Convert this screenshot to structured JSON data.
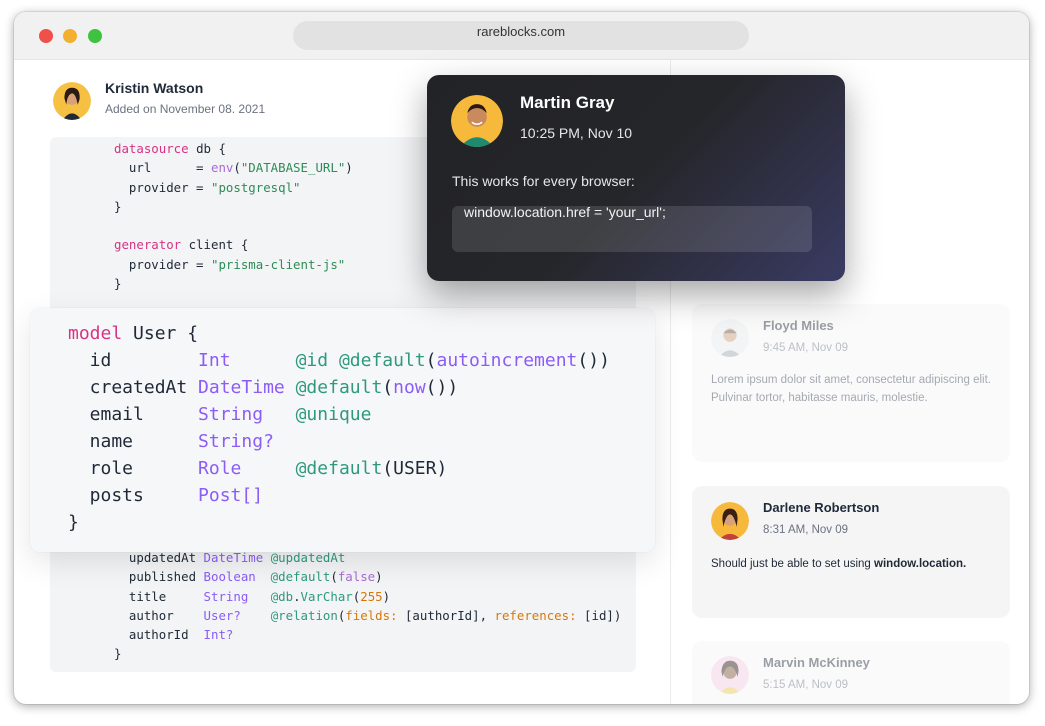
{
  "browser": {
    "url": "rareblocks.com"
  },
  "post": {
    "author": "Kristin Watson",
    "date": "Added on November 08. 2021"
  },
  "code_top": [
    [
      {
        "t": "datasource",
        "c": "kw"
      },
      {
        "t": " db {"
      }
    ],
    [
      {
        "t": "  url      = "
      },
      {
        "t": "env",
        "c": "fn"
      },
      {
        "t": "("
      },
      {
        "t": "\"DATABASE_URL\"",
        "c": "str"
      },
      {
        "t": ")"
      }
    ],
    [
      {
        "t": "  provider = "
      },
      {
        "t": "\"postgresql\"",
        "c": "str"
      }
    ],
    [
      {
        "t": "}"
      }
    ],
    [
      {
        "t": ""
      }
    ],
    [
      {
        "t": "generator",
        "c": "kw"
      },
      {
        "t": " client {"
      }
    ],
    [
      {
        "t": "  provider = "
      },
      {
        "t": "\"prisma-client-js\"",
        "c": "str"
      }
    ],
    [
      {
        "t": "}"
      }
    ]
  ],
  "code_bottom": [
    [
      {
        "t": "  updatedAt "
      },
      {
        "t": "DateTime",
        "c": "type"
      },
      {
        "t": " "
      },
      {
        "t": "@updatedAt",
        "c": "attr"
      }
    ],
    [
      {
        "t": "  published "
      },
      {
        "t": "Boolean",
        "c": "type"
      },
      {
        "t": "  "
      },
      {
        "t": "@default",
        "c": "attr"
      },
      {
        "t": "("
      },
      {
        "t": "false",
        "c": "fn"
      },
      {
        "t": ")"
      }
    ],
    [
      {
        "t": "  title     "
      },
      {
        "t": "String",
        "c": "type"
      },
      {
        "t": "   "
      },
      {
        "t": "@db",
        "c": "attr"
      },
      {
        "t": "."
      },
      {
        "t": "VarChar",
        "c": "attr"
      },
      {
        "t": "("
      },
      {
        "t": "255",
        "c": "num"
      },
      {
        "t": ")"
      }
    ],
    [
      {
        "t": "  author    "
      },
      {
        "t": "User?",
        "c": "type"
      },
      {
        "t": "    "
      },
      {
        "t": "@relation",
        "c": "attr"
      },
      {
        "t": "("
      },
      {
        "t": "fields:",
        "c": "ref"
      },
      {
        "t": " [authorId], "
      },
      {
        "t": "references:",
        "c": "ref"
      },
      {
        "t": " [id])"
      }
    ],
    [
      {
        "t": "  authorId  "
      },
      {
        "t": "Int?",
        "c": "type"
      }
    ],
    [
      {
        "t": "}"
      }
    ]
  ],
  "code_focus": [
    [
      {
        "t": "model",
        "c": "kw"
      },
      {
        "t": " User {"
      }
    ],
    [
      {
        "t": "  id        "
      },
      {
        "t": "Int",
        "c": "type"
      },
      {
        "t": "      "
      },
      {
        "t": "@id",
        "c": "attr"
      },
      {
        "t": " "
      },
      {
        "t": "@default",
        "c": "attr"
      },
      {
        "t": "("
      },
      {
        "t": "autoincrement",
        "c": "func"
      },
      {
        "t": "())"
      }
    ],
    [
      {
        "t": "  createdAt "
      },
      {
        "t": "DateTime",
        "c": "type"
      },
      {
        "t": " "
      },
      {
        "t": "@default",
        "c": "attr"
      },
      {
        "t": "("
      },
      {
        "t": "now",
        "c": "func"
      },
      {
        "t": "())"
      }
    ],
    [
      {
        "t": "  email     "
      },
      {
        "t": "String",
        "c": "type"
      },
      {
        "t": "   "
      },
      {
        "t": "@unique",
        "c": "attr"
      }
    ],
    [
      {
        "t": "  name      "
      },
      {
        "t": "String?",
        "c": "type"
      }
    ],
    [
      {
        "t": "  role      "
      },
      {
        "t": "Role",
        "c": "type"
      },
      {
        "t": "     "
      },
      {
        "t": "@default",
        "c": "attr"
      },
      {
        "t": "(USER)"
      }
    ],
    [
      {
        "t": "  posts     "
      },
      {
        "t": "Post[]",
        "c": "type"
      }
    ],
    [
      {
        "t": "}"
      }
    ]
  ],
  "popup": {
    "name": "Martin Gray",
    "time": "10:25 PM, Nov 10",
    "message": "This works for every browser:",
    "code": "window.location.href = 'your_url';"
  },
  "comments": [
    {
      "name": "Floyd Miles",
      "time": "9:45 AM, Nov 09",
      "body": "Lorem ipsum dolor sit amet, consectetur adipiscing elit. Pulvinar tortor, habitasse mauris, molestie."
    },
    {
      "name": "Darlene Robertson",
      "time": "8:31 AM, Nov 09",
      "body_prefix": "Should just be able to set using ",
      "body_code": "window.location."
    },
    {
      "name": "Marvin McKinney",
      "time": "5:15 AM, Nov 09"
    }
  ],
  "colors": {
    "popup_bg": "#222327",
    "accent_gradient": "#3a3b63",
    "keyword": "#d63384",
    "string": "#2e8b57",
    "type": "#8b5cf6"
  }
}
